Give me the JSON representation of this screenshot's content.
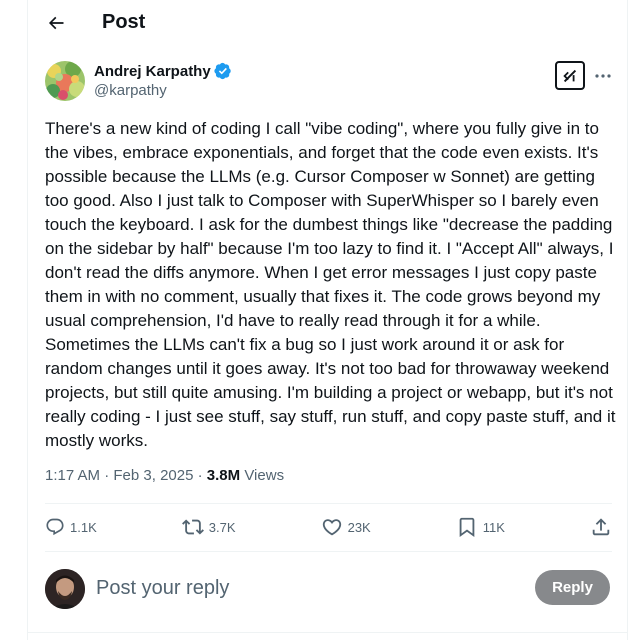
{
  "header": {
    "title": "Post",
    "back_icon": "arrow-left-icon"
  },
  "author": {
    "name": "Andrej Karpathy",
    "handle": "@karpathy",
    "verified_color": "#1d9bf0"
  },
  "tweet": {
    "text": "There's a new kind of coding I call \"vibe coding\", where you fully give in to the vibes, embrace exponentials, and forget that the code even exists. It's possible because the LLMs (e.g. Cursor Composer w Sonnet) are getting too good. Also I just talk to Composer with SuperWhisper so I barely even touch the keyboard. I ask for the dumbest things like \"decrease the padding on the sidebar by half\" because I'm too lazy to find it. I \"Accept All\" always, I don't read the diffs anymore. When I get error messages I just copy paste them in with no comment, usually that fixes it. The code grows beyond my usual comprehension, I'd have to really read through it for a while. Sometimes the LLMs can't fix a bug so I just work around it or ask for random changes until it goes away. It's not too bad for throwaway weekend projects, but still quite amusing. I'm building a project or webapp, but it's not really coding - I just see stuff, say stuff, run stuff, and copy paste stuff, and it mostly works.",
    "time": "1:17 AM",
    "date": "Feb 3, 2025",
    "views_count": "3.8M",
    "views_label": "Views",
    "separator": "·"
  },
  "actions": {
    "replies": "1.1K",
    "reposts": "3.7K",
    "likes": "23K",
    "bookmarks": "11K"
  },
  "reply": {
    "placeholder": "Post your reply",
    "button_label": "Reply"
  },
  "colors": {
    "text_primary": "#0f1419",
    "text_secondary": "#536471",
    "reply_button_bg": "#87898c",
    "border": "#eff3f4"
  }
}
